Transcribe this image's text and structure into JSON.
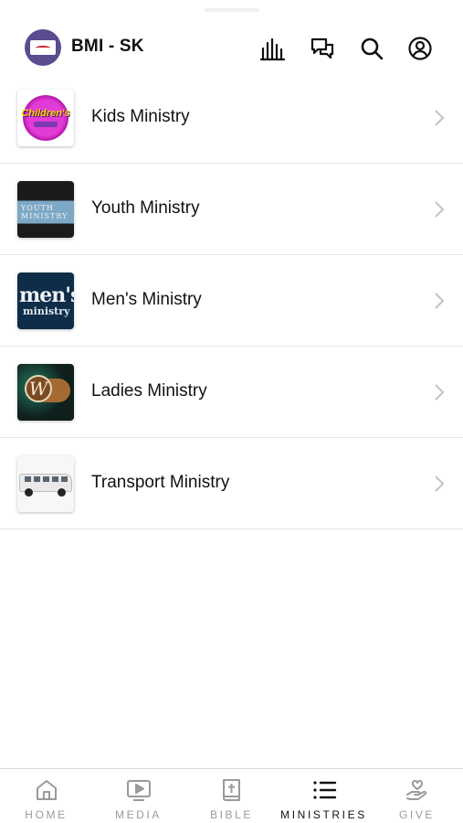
{
  "header": {
    "title": "BMI - SK",
    "icons": [
      "stats-icon",
      "chat-icon",
      "search-icon",
      "profile-icon"
    ]
  },
  "ministries": [
    {
      "label": "Kids Ministry",
      "thumb_text": "Children's",
      "thumb_subtext": "MINISTRY"
    },
    {
      "label": "Youth Ministry",
      "thumb_text": "YOUTH MINISTRY"
    },
    {
      "label": "Men's Ministry",
      "thumb_text": "men's",
      "thumb_subtext": "ministry"
    },
    {
      "label": "Ladies Ministry",
      "thumb_text": "W"
    },
    {
      "label": "Transport Ministry"
    }
  ],
  "tabs": [
    {
      "label": "HOME",
      "icon": "home-icon"
    },
    {
      "label": "MEDIA",
      "icon": "media-icon"
    },
    {
      "label": "BIBLE",
      "icon": "bible-icon"
    },
    {
      "label": "MINISTRIES",
      "icon": "list-icon",
      "active": true
    },
    {
      "label": "GIVE",
      "icon": "give-icon"
    }
  ],
  "colors": {
    "active_tab": "#111111",
    "inactive_tab": "#9a9a9a",
    "divider": "#e6e6e6",
    "logo_bg": "#5b4b8f"
  }
}
